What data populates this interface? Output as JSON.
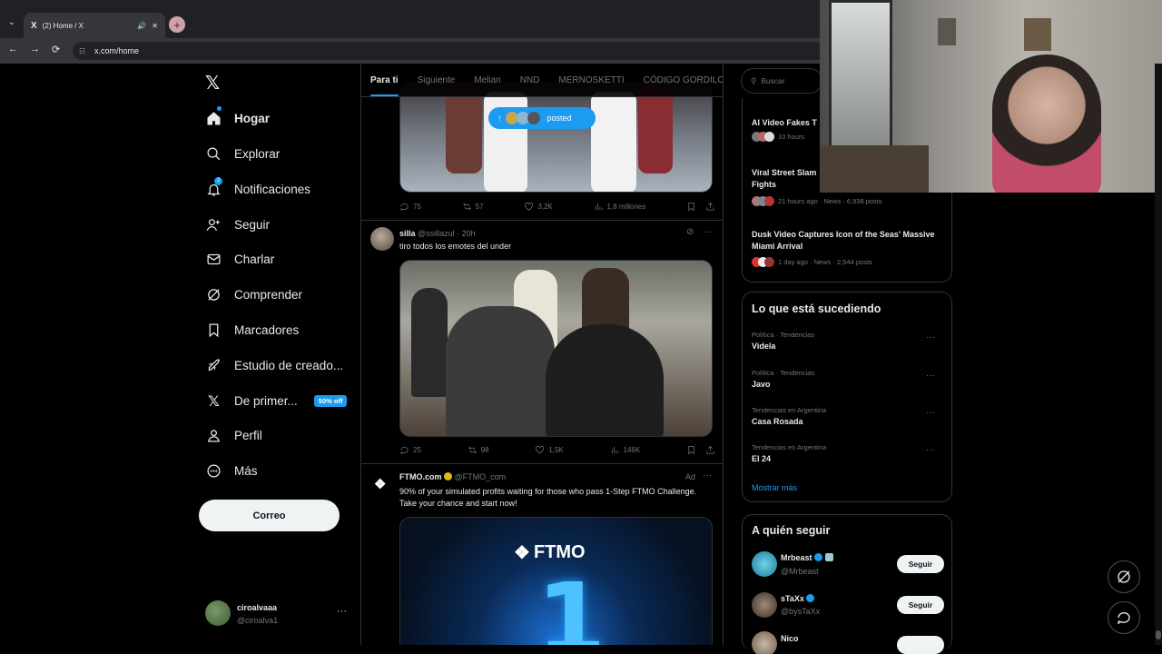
{
  "browser": {
    "tab_title": "(2) Home / X",
    "url": "x.com/home"
  },
  "nav": {
    "items": [
      {
        "label": "Hogar",
        "icon": "home-icon",
        "bold": true
      },
      {
        "label": "Explorar",
        "icon": "search-icon"
      },
      {
        "label": "Notificaciones",
        "icon": "bell-icon",
        "badge": "2"
      },
      {
        "label": "Seguir",
        "icon": "add-person-icon"
      },
      {
        "label": "Charlar",
        "icon": "mail-icon"
      },
      {
        "label": "Comprender",
        "icon": "grok-icon"
      },
      {
        "label": "Marcadores",
        "icon": "bookmark-icon"
      },
      {
        "label": "Estudio de creado...",
        "icon": "rocket-icon"
      },
      {
        "label": "De primer...",
        "icon": "x-logo-icon",
        "tag": "50% off"
      },
      {
        "label": "Perfil",
        "icon": "person-icon"
      },
      {
        "label": "Más",
        "icon": "more-circle-icon"
      }
    ],
    "post_button": "Correo",
    "account": {
      "name": "ciroalvaaa",
      "handle": "@ciroalva1"
    }
  },
  "feed": {
    "tabs": [
      "Para ti",
      "Siguiente",
      "Melian",
      "NND",
      "MERNOSKETTI",
      "CÓDIGO GORDILON"
    ],
    "new_posts_pill": "posted",
    "post1_actions": {
      "replies": "75",
      "reposts": "57",
      "likes": "3,2K",
      "views": "1,8 millones"
    },
    "post2": {
      "name": "silla",
      "handle": "@ssillazul · 20h",
      "text": "tiro todos los emotes del under",
      "actions": {
        "replies": "25",
        "reposts": "98",
        "likes": "1,5K",
        "views": "146K"
      }
    },
    "ad": {
      "name": "FTMO.com",
      "handle": "@FTMO_com",
      "ad_label": "Ad",
      "text": "90% of your simulated profits waiting for those who pass 1-Step FTMO Challenge. Take your chance and start now!",
      "brand": "FTMO",
      "big_digit": "1"
    }
  },
  "right": {
    "search_placeholder": "Buscar",
    "news": [
      {
        "title": "AI Video Fakes T",
        "meta": "10 hours"
      },
      {
        "title": "Viral Street Slam Fights",
        "meta": "21 hours ago · News · 6,938 posts"
      },
      {
        "title": "Dusk Video Captures Icon of the Seas' Massive Miami Arrival",
        "meta": "1 day ago · News · 2,544 posts"
      }
    ],
    "trends_title": "Lo que está sucediendo",
    "trends": [
      {
        "category": "Política · Tendencias",
        "name": "Videla"
      },
      {
        "category": "Política · Tendencias",
        "name": "Javo"
      },
      {
        "category": "Tendencias en Argentina",
        "name": "Casa Rosada"
      },
      {
        "category": "Tendencias en Argentina",
        "name": "El 24"
      }
    ],
    "show_more": "Mostrar más",
    "follow_title": "A quién seguir",
    "follow": [
      {
        "name": "Mrbeast",
        "handle": "@Mrbeast",
        "button": "Seguir"
      },
      {
        "name": "sTaXx",
        "handle": "@bysTaXx",
        "button": "Seguir"
      },
      {
        "name": "Nico",
        "handle": "",
        "button": ""
      }
    ]
  },
  "colors": {
    "accent": "#1d9bf0",
    "background": "#000000",
    "border": "#2f3336"
  }
}
